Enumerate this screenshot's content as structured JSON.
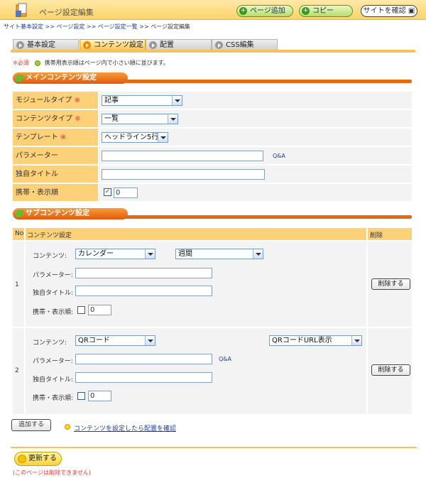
{
  "header": {
    "title": "ページ設定編集",
    "add_page": "ページ追加",
    "copy": "コピー",
    "view_site": "サイトを確認"
  },
  "breadcrumb": {
    "b1": "サイト基本設定",
    "sep": ">>",
    "b2": "ページ設定",
    "b3": "ページ設定一覧",
    "current": "ページ設定編集"
  },
  "tabs": [
    "基本設定",
    "コンテンツ設定",
    "配置",
    "CSS編集"
  ],
  "notes": {
    "required_mark": "※必須",
    "mobile_note": "携帯用表示順はページ内で小さい順に並びます。"
  },
  "main": {
    "section_title": "メインコンテンツ設定",
    "req_star": "※",
    "module_label": "モジュールタイプ",
    "module_value": "記事",
    "content_type_label": "コンテンツタイプ",
    "content_type_value": "一覧",
    "template_label": "テンプレート",
    "template_value": "ヘッドライン5行",
    "param_label": "パラメーター",
    "param_value": "",
    "qa": "Q&A",
    "title_label": "独自タイトル",
    "title_value": "",
    "mobile_label": "携帯・表示順",
    "mobile_check": "✓",
    "mobile_order": "0"
  },
  "sub": {
    "section_title": "サブコンテンツ設定",
    "col_no": "No",
    "col_setting": "コンテンツ設定",
    "col_delete": "削除",
    "content_label": "コンテンツ:",
    "param_label": "パラメーター:",
    "title_label": "独自タイトル:",
    "mobile_label": "携帯・表示順:",
    "delete_label": "削除する",
    "qa": "Q&A",
    "rows": [
      {
        "no": "1",
        "content": "カレンダー",
        "option": "週間",
        "param": "",
        "title": "",
        "order": "0"
      },
      {
        "no": "2",
        "content": "QRコード",
        "option": "QRコードURL表示",
        "param": "",
        "title": "",
        "order": "0"
      }
    ]
  },
  "footer": {
    "add_label": "追加する",
    "confirm_link": "コンテンツを設定したら配置を確認",
    "update_label": "更新する",
    "no_delete": "(このページは削除できません)"
  }
}
